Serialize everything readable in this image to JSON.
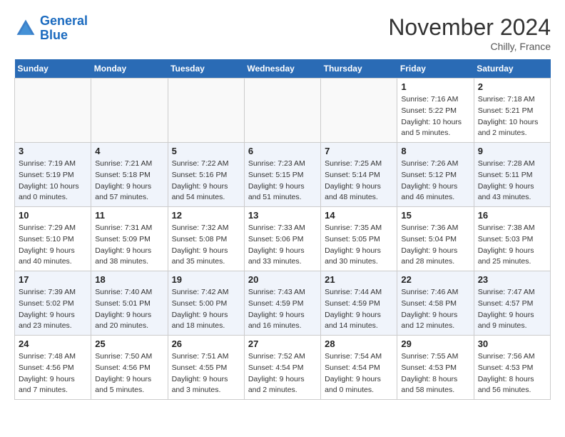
{
  "header": {
    "logo_line1": "General",
    "logo_line2": "Blue",
    "month": "November 2024",
    "location": "Chilly, France"
  },
  "weekdays": [
    "Sunday",
    "Monday",
    "Tuesday",
    "Wednesday",
    "Thursday",
    "Friday",
    "Saturday"
  ],
  "weeks": [
    [
      {
        "day": "",
        "info": ""
      },
      {
        "day": "",
        "info": ""
      },
      {
        "day": "",
        "info": ""
      },
      {
        "day": "",
        "info": ""
      },
      {
        "day": "",
        "info": ""
      },
      {
        "day": "1",
        "info": "Sunrise: 7:16 AM\nSunset: 5:22 PM\nDaylight: 10 hours\nand 5 minutes."
      },
      {
        "day": "2",
        "info": "Sunrise: 7:18 AM\nSunset: 5:21 PM\nDaylight: 10 hours\nand 2 minutes."
      }
    ],
    [
      {
        "day": "3",
        "info": "Sunrise: 7:19 AM\nSunset: 5:19 PM\nDaylight: 10 hours\nand 0 minutes."
      },
      {
        "day": "4",
        "info": "Sunrise: 7:21 AM\nSunset: 5:18 PM\nDaylight: 9 hours\nand 57 minutes."
      },
      {
        "day": "5",
        "info": "Sunrise: 7:22 AM\nSunset: 5:16 PM\nDaylight: 9 hours\nand 54 minutes."
      },
      {
        "day": "6",
        "info": "Sunrise: 7:23 AM\nSunset: 5:15 PM\nDaylight: 9 hours\nand 51 minutes."
      },
      {
        "day": "7",
        "info": "Sunrise: 7:25 AM\nSunset: 5:14 PM\nDaylight: 9 hours\nand 48 minutes."
      },
      {
        "day": "8",
        "info": "Sunrise: 7:26 AM\nSunset: 5:12 PM\nDaylight: 9 hours\nand 46 minutes."
      },
      {
        "day": "9",
        "info": "Sunrise: 7:28 AM\nSunset: 5:11 PM\nDaylight: 9 hours\nand 43 minutes."
      }
    ],
    [
      {
        "day": "10",
        "info": "Sunrise: 7:29 AM\nSunset: 5:10 PM\nDaylight: 9 hours\nand 40 minutes."
      },
      {
        "day": "11",
        "info": "Sunrise: 7:31 AM\nSunset: 5:09 PM\nDaylight: 9 hours\nand 38 minutes."
      },
      {
        "day": "12",
        "info": "Sunrise: 7:32 AM\nSunset: 5:08 PM\nDaylight: 9 hours\nand 35 minutes."
      },
      {
        "day": "13",
        "info": "Sunrise: 7:33 AM\nSunset: 5:06 PM\nDaylight: 9 hours\nand 33 minutes."
      },
      {
        "day": "14",
        "info": "Sunrise: 7:35 AM\nSunset: 5:05 PM\nDaylight: 9 hours\nand 30 minutes."
      },
      {
        "day": "15",
        "info": "Sunrise: 7:36 AM\nSunset: 5:04 PM\nDaylight: 9 hours\nand 28 minutes."
      },
      {
        "day": "16",
        "info": "Sunrise: 7:38 AM\nSunset: 5:03 PM\nDaylight: 9 hours\nand 25 minutes."
      }
    ],
    [
      {
        "day": "17",
        "info": "Sunrise: 7:39 AM\nSunset: 5:02 PM\nDaylight: 9 hours\nand 23 minutes."
      },
      {
        "day": "18",
        "info": "Sunrise: 7:40 AM\nSunset: 5:01 PM\nDaylight: 9 hours\nand 20 minutes."
      },
      {
        "day": "19",
        "info": "Sunrise: 7:42 AM\nSunset: 5:00 PM\nDaylight: 9 hours\nand 18 minutes."
      },
      {
        "day": "20",
        "info": "Sunrise: 7:43 AM\nSunset: 4:59 PM\nDaylight: 9 hours\nand 16 minutes."
      },
      {
        "day": "21",
        "info": "Sunrise: 7:44 AM\nSunset: 4:59 PM\nDaylight: 9 hours\nand 14 minutes."
      },
      {
        "day": "22",
        "info": "Sunrise: 7:46 AM\nSunset: 4:58 PM\nDaylight: 9 hours\nand 12 minutes."
      },
      {
        "day": "23",
        "info": "Sunrise: 7:47 AM\nSunset: 4:57 PM\nDaylight: 9 hours\nand 9 minutes."
      }
    ],
    [
      {
        "day": "24",
        "info": "Sunrise: 7:48 AM\nSunset: 4:56 PM\nDaylight: 9 hours\nand 7 minutes."
      },
      {
        "day": "25",
        "info": "Sunrise: 7:50 AM\nSunset: 4:56 PM\nDaylight: 9 hours\nand 5 minutes."
      },
      {
        "day": "26",
        "info": "Sunrise: 7:51 AM\nSunset: 4:55 PM\nDaylight: 9 hours\nand 3 minutes."
      },
      {
        "day": "27",
        "info": "Sunrise: 7:52 AM\nSunset: 4:54 PM\nDaylight: 9 hours\nand 2 minutes."
      },
      {
        "day": "28",
        "info": "Sunrise: 7:54 AM\nSunset: 4:54 PM\nDaylight: 9 hours\nand 0 minutes."
      },
      {
        "day": "29",
        "info": "Sunrise: 7:55 AM\nSunset: 4:53 PM\nDaylight: 8 hours\nand 58 minutes."
      },
      {
        "day": "30",
        "info": "Sunrise: 7:56 AM\nSunset: 4:53 PM\nDaylight: 8 hours\nand 56 minutes."
      }
    ]
  ]
}
